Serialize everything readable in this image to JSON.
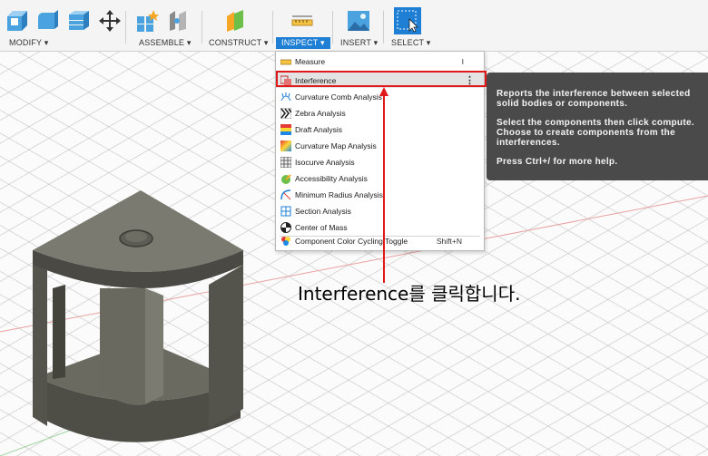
{
  "toolbar": {
    "groups": [
      {
        "label": "MODIFY ▾",
        "active": false
      },
      {
        "label": "ASSEMBLE ▾",
        "active": false
      },
      {
        "label": "CONSTRUCT ▾",
        "active": false
      },
      {
        "label": "INSPECT ▾",
        "active": true
      },
      {
        "label": "INSERT ▾",
        "active": false
      },
      {
        "label": "SELECT ▾",
        "active": false
      }
    ],
    "icons": [
      "press-pull-icon",
      "fillet-icon",
      "shell-icon",
      "move-icon",
      "new-component-icon",
      "joint-icon",
      "offset-plane-icon",
      "measure-icon",
      "insert-image-icon",
      "select-box-icon"
    ]
  },
  "inspect_menu": {
    "items": [
      {
        "label": "Measure",
        "shortcut": "I",
        "icon": "ruler-icon"
      },
      {
        "label": "Interference",
        "shortcut": "",
        "icon": "interference-icon",
        "highlighted": true
      },
      {
        "label": "Curvature Comb Analysis",
        "shortcut": "",
        "icon": "curvature-comb-icon"
      },
      {
        "label": "Zebra Analysis",
        "shortcut": "",
        "icon": "zebra-icon"
      },
      {
        "label": "Draft Analysis",
        "shortcut": "",
        "icon": "draft-icon"
      },
      {
        "label": "Curvature Map Analysis",
        "shortcut": "",
        "icon": "curvature-map-icon"
      },
      {
        "label": "Isocurve Analysis",
        "shortcut": "",
        "icon": "isocurve-icon"
      },
      {
        "label": "Accessibility Analysis",
        "shortcut": "",
        "icon": "accessibility-icon"
      },
      {
        "label": "Minimum Radius Analysis",
        "shortcut": "",
        "icon": "minimum-radius-icon"
      },
      {
        "label": "Section Analysis",
        "shortcut": "",
        "icon": "section-icon"
      },
      {
        "label": "Center of Mass",
        "shortcut": "",
        "icon": "center-of-mass-icon"
      },
      {
        "label": "Component Color Cycling Toggle",
        "shortcut": "Shift+N",
        "icon": "color-cycling-icon"
      }
    ],
    "more_options": "⋮"
  },
  "tooltip": {
    "line1": "Reports the interference between selected",
    "line2": "solid bodies or components.",
    "line3": "Select the components then click compute.",
    "line4": "Choose to create components from the",
    "line5": "interferences.",
    "line6": "Press Ctrl+/ for more help."
  },
  "annotation": {
    "text": "Interference를 클릭합니다.",
    "highlight_color": "#e01a1a"
  },
  "colors": {
    "accent": "#1e7fd4",
    "tooltip_bg": "#4a4a4a",
    "model": "#5b5a52"
  }
}
